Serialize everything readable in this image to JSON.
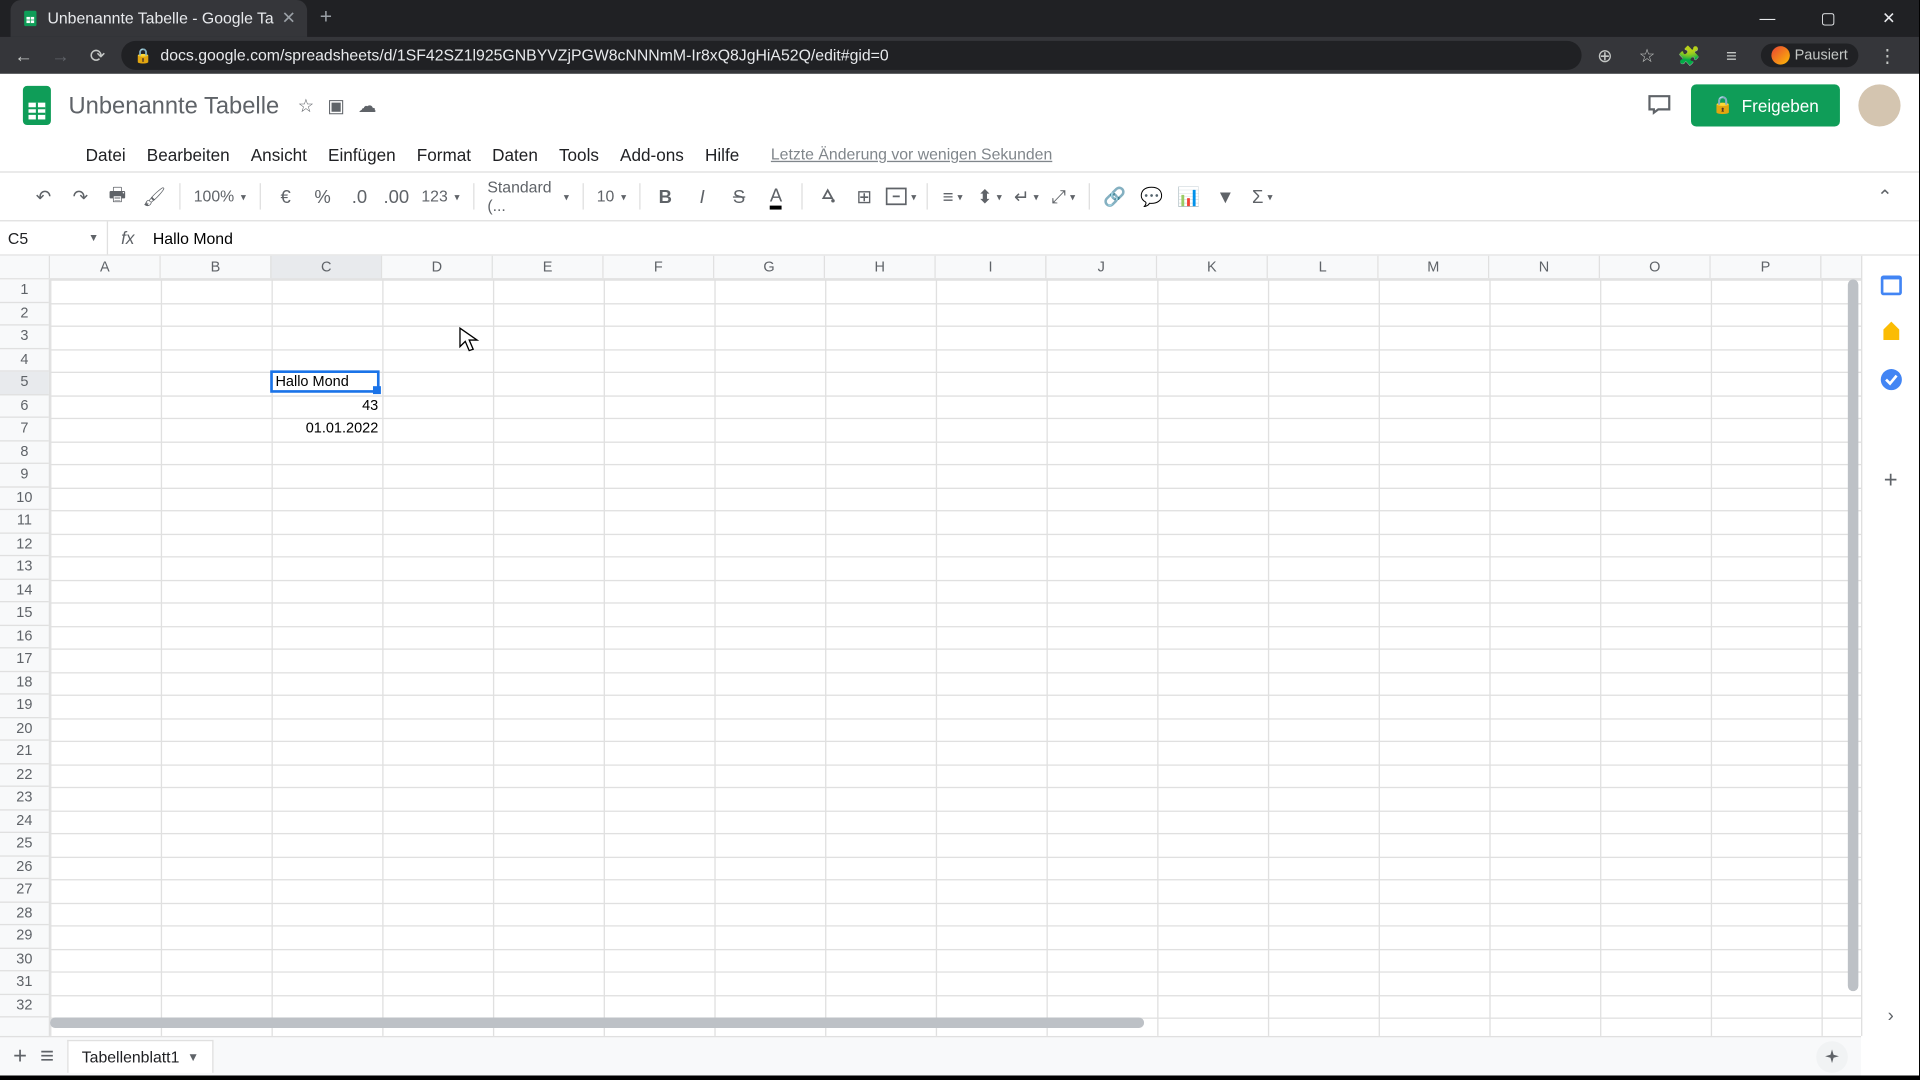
{
  "browser": {
    "tab_title": "Unbenannte Tabelle - Google Ta",
    "url": "docs.google.com/spreadsheets/d/1SF42SZ1l925GNBYVZjPGW8cNNNmM-Ir8xQ8JgHiA52Q/edit#gid=0",
    "profile_status": "Pausiert"
  },
  "doc": {
    "title": "Unbenannte Tabelle",
    "share_label": "Freigeben",
    "last_edit": "Letzte Änderung vor wenigen Sekunden"
  },
  "menus": [
    "Datei",
    "Bearbeiten",
    "Ansicht",
    "Einfügen",
    "Format",
    "Daten",
    "Tools",
    "Add-ons",
    "Hilfe"
  ],
  "toolbar": {
    "zoom": "100%",
    "currency": "€",
    "format_select": "Standard (...",
    "font_size": "10"
  },
  "name_box": "C5",
  "formula_value": "Hallo Mond",
  "columns": [
    "A",
    "B",
    "C",
    "D",
    "E",
    "F",
    "G",
    "H",
    "I",
    "J",
    "K",
    "L",
    "M",
    "N",
    "O",
    "P"
  ],
  "row_count": 32,
  "cells": {
    "C5": {
      "value": "Hallo Mond",
      "align": "left"
    },
    "C6": {
      "value": "43",
      "align": "right"
    },
    "C7": {
      "value": "01.01.2022",
      "align": "right"
    }
  },
  "selected_cell": "C5",
  "sheet_tab": "Tabellenblatt1"
}
